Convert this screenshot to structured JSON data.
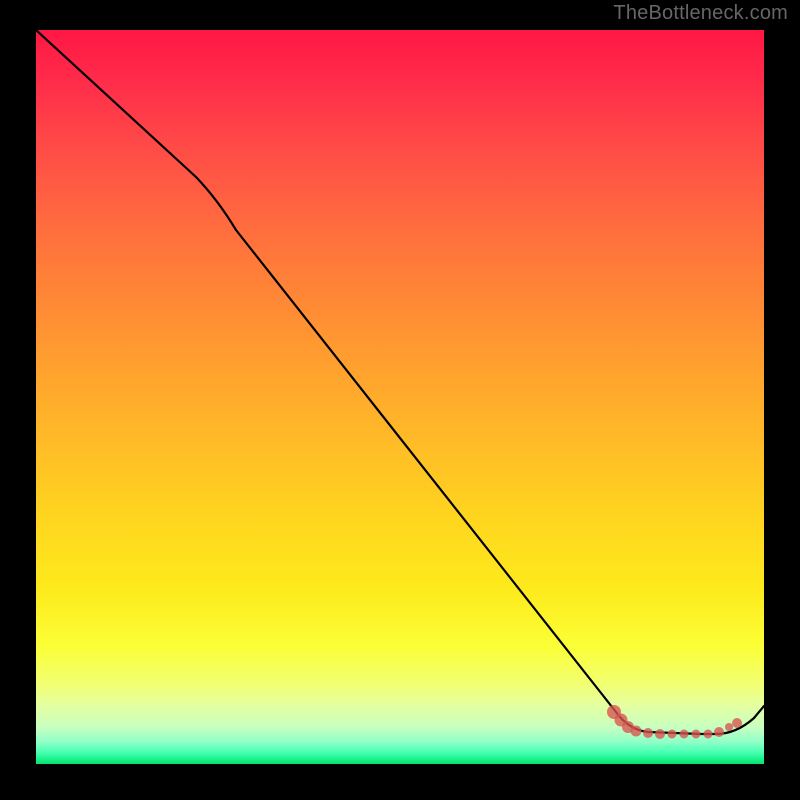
{
  "attribution": "TheBottleneck.com",
  "colors": {
    "gradient_top": "#ff1744",
    "gradient_mid": "#ffd41f",
    "gradient_bottom": "#00e46e",
    "curve": "#000000",
    "markers": "#d9534f",
    "background": "#000000"
  },
  "chart_data": {
    "type": "line",
    "title": "",
    "xlabel": "",
    "ylabel": "",
    "xlim": [
      0,
      100
    ],
    "ylim": [
      0,
      100
    ],
    "series": [
      {
        "name": "bottleneck-curve",
        "x": [
          0,
          22,
          28,
          80,
          84,
          92,
          95,
          100
        ],
        "y": [
          100,
          80,
          73,
          7,
          4,
          4,
          4,
          8
        ]
      }
    ],
    "markers": {
      "name": "optimal-zone-points",
      "x": [
        79,
        80,
        81,
        82,
        84,
        86,
        87,
        89,
        91,
        92,
        94,
        95,
        96
      ],
      "y": [
        7,
        6,
        5,
        4.5,
        4,
        4,
        4,
        4,
        4,
        4,
        4.3,
        5,
        5.5
      ]
    },
    "background_gradient": {
      "orientation": "vertical",
      "stops": [
        {
          "pos": 0.0,
          "color": "#ff1744"
        },
        {
          "pos": 0.5,
          "color": "#ffbb27"
        },
        {
          "pos": 0.8,
          "color": "#fdea1c"
        },
        {
          "pos": 1.0,
          "color": "#00e46e"
        }
      ]
    }
  }
}
